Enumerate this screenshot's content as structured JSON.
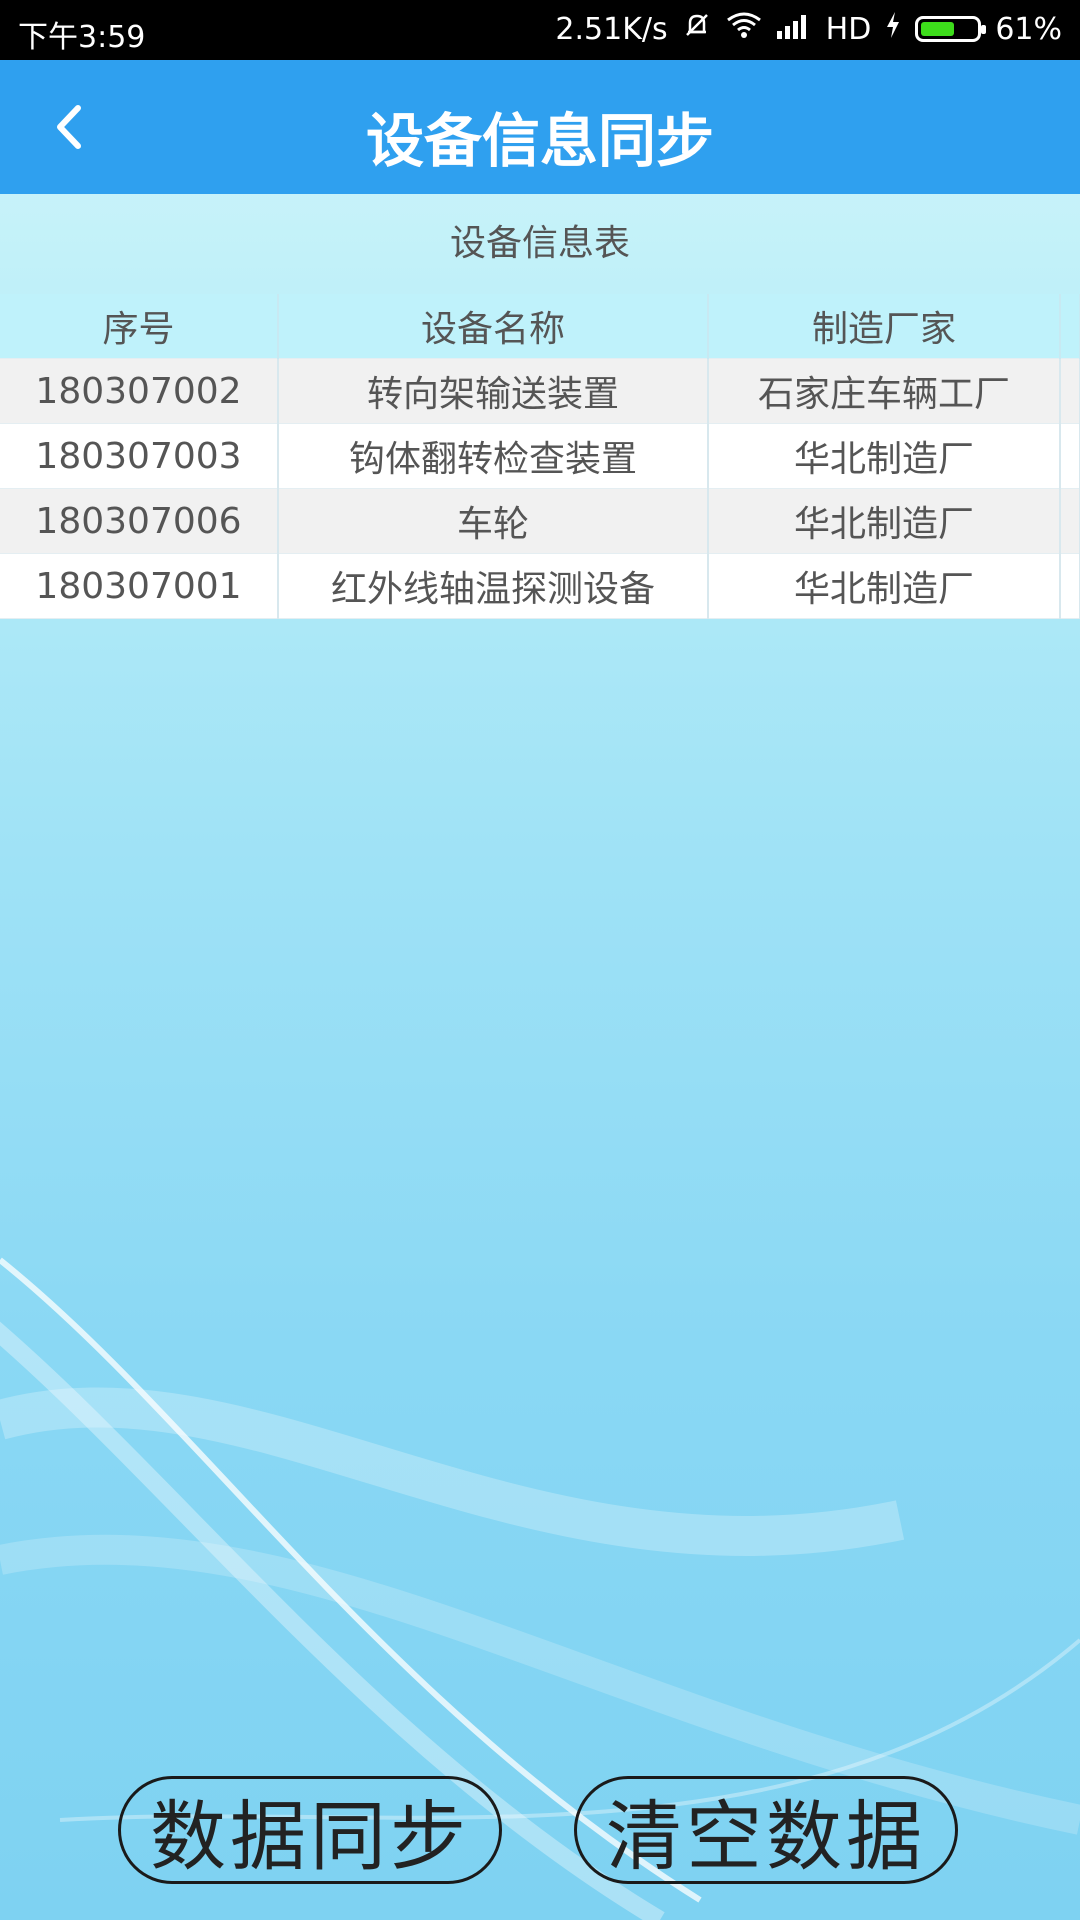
{
  "status_bar": {
    "time": "下午3:59",
    "network_speed": "2.51K/s",
    "network_type": "HD",
    "battery_percent": "61%",
    "battery_level": 0.61,
    "icons": [
      "mute-bell-icon",
      "wifi-icon",
      "signal-icon",
      "charging-icon",
      "battery-icon"
    ]
  },
  "header": {
    "title": "设备信息同步",
    "back_icon": "chevron-left-icon"
  },
  "table": {
    "caption": "设备信息表",
    "columns": [
      "序号",
      "设备名称",
      "制造厂家"
    ],
    "rows": [
      {
        "id": "180307002",
        "name": "转向架输送装置",
        "maker": "石家庄车辆工厂"
      },
      {
        "id": "180307003",
        "name": "钩体翻转检查装置",
        "maker": "华北制造厂"
      },
      {
        "id": "180307006",
        "name": "车轮",
        "maker": "华北制造厂"
      },
      {
        "id": "180307001",
        "name": "红外线轴温探测设备",
        "maker": "华北制造厂"
      }
    ]
  },
  "buttons": {
    "sync_label": "数据同步",
    "clear_label": "清空数据"
  },
  "colors": {
    "app_bar": "#2fa0ef",
    "header_row": "#bff2fb",
    "battery_fill": "#3ddc1b"
  }
}
